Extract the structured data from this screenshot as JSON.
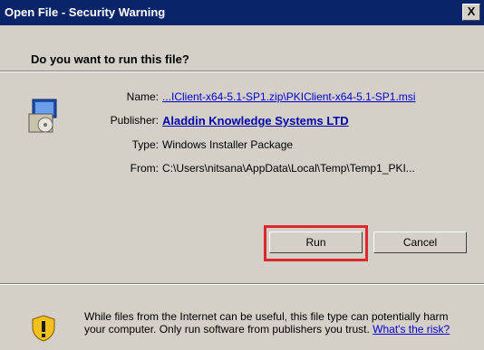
{
  "window": {
    "title": "Open File - Security Warning",
    "close_glyph": "X"
  },
  "prompt": "Do you want to run this file?",
  "file_info": {
    "name_label": "Name:",
    "name_value": "...IClient-x64-5.1-SP1.zip\\PKIClient-x64-5.1-SP1.msi",
    "publisher_label": "Publisher:",
    "publisher_value": "Aladdin Knowledge Systems LTD",
    "type_label": "Type:",
    "type_value": "Windows Installer Package",
    "from_label": "From:",
    "from_value": "C:\\Users\\nitsana\\AppData\\Local\\Temp\\Temp1_PKI..."
  },
  "buttons": {
    "run_label": "Run",
    "cancel_label": "Cancel"
  },
  "warning": {
    "text": "While files from the Internet can be useful, this file type can potentially harm your computer. Only run software from publishers you trust.",
    "link": "What's the risk?"
  },
  "colors": {
    "titlebar": "#0a246a",
    "highlight": "#d9282e",
    "link": "#0000cc"
  },
  "icons": [
    "installer-package-icon",
    "shield-warning-icon",
    "close-icon"
  ]
}
